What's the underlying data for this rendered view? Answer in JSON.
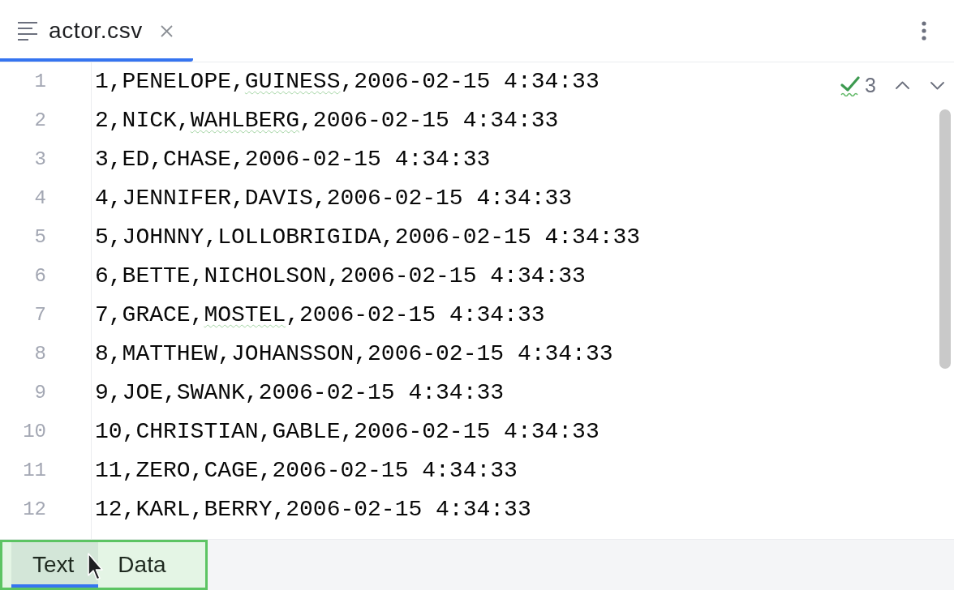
{
  "editor_tabs": [
    {
      "label": "actor.csv",
      "selected": true
    }
  ],
  "inspections": {
    "count": "3"
  },
  "lines": [
    {
      "number": "1",
      "segments": [
        {
          "text": "1,PENELOPE,",
          "typo": false
        },
        {
          "text": "GUINESS",
          "typo": true
        },
        {
          "text": ",2006-02-15 4:34:33",
          "typo": false
        }
      ]
    },
    {
      "number": "2",
      "segments": [
        {
          "text": "2,NICK,",
          "typo": false
        },
        {
          "text": "WAHLBERG",
          "typo": true
        },
        {
          "text": ",2006-02-15 4:34:33",
          "typo": false
        }
      ]
    },
    {
      "number": "3",
      "segments": [
        {
          "text": "3,ED,CHASE,2006-02-15 4:34:33",
          "typo": false
        }
      ]
    },
    {
      "number": "4",
      "segments": [
        {
          "text": "4,JENNIFER,DAVIS,2006-02-15 4:34:33",
          "typo": false
        }
      ]
    },
    {
      "number": "5",
      "segments": [
        {
          "text": "5,JOHNNY,LOLLOBRIGIDA,2006-02-15 4:34:33",
          "typo": false
        }
      ]
    },
    {
      "number": "6",
      "segments": [
        {
          "text": "6,BETTE,NICHOLSON,2006-02-15 4:34:33",
          "typo": false
        }
      ]
    },
    {
      "number": "7",
      "segments": [
        {
          "text": "7,GRACE,",
          "typo": false
        },
        {
          "text": "MOSTEL",
          "typo": true
        },
        {
          "text": ",2006-02-15 4:34:33",
          "typo": false
        }
      ]
    },
    {
      "number": "8",
      "segments": [
        {
          "text": "8,MATTHEW,JOHANSSON,2006-02-15 4:34:33",
          "typo": false
        }
      ]
    },
    {
      "number": "9",
      "segments": [
        {
          "text": "9,JOE,SWANK,2006-02-15 4:34:33",
          "typo": false
        }
      ]
    },
    {
      "number": "10",
      "segments": [
        {
          "text": "10,CHRISTIAN,GABLE,2006-02-15 4:34:33",
          "typo": false
        }
      ]
    },
    {
      "number": "11",
      "segments": [
        {
          "text": "11,ZERO,CAGE,2006-02-15 4:34:33",
          "typo": false
        }
      ]
    },
    {
      "number": "12",
      "segments": [
        {
          "text": "12,KARL,BERRY,2006-02-15 4:34:33",
          "typo": false
        }
      ]
    }
  ],
  "view_tabs": [
    {
      "label": "Text",
      "selected": true
    },
    {
      "label": "Data",
      "selected": false
    }
  ]
}
